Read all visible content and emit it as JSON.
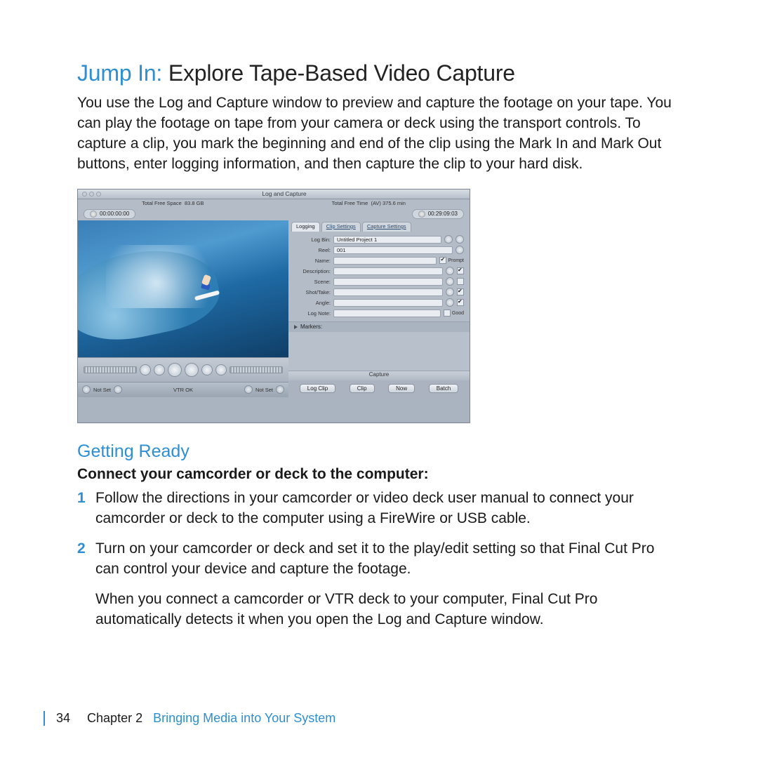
{
  "heading": {
    "jump": "Jump In:",
    "rest": " Explore Tape-Based Video Capture"
  },
  "intro": "You use the Log and Capture window to preview and capture the footage on your tape. You can play the footage on tape from your camera or deck using the transport controls. To capture a clip, you mark the beginning and end of the clip using the Mark In and Mark Out buttons, enter logging information, and then capture the clip to your hard disk.",
  "screenshot": {
    "title": "Log and Capture",
    "free_space_label": "Total Free Space",
    "free_space_value": "83.8 GB",
    "free_time_label": "Total Free Time",
    "free_time_value": "(AV) 375.6 min",
    "tc_in": "00:00:00:00",
    "tc_out": "00:29:09:03",
    "tabs": {
      "logging": "Logging",
      "clip": "Clip Settings",
      "capture": "Capture Settings"
    },
    "fields": {
      "log_bin_label": "Log Bin:",
      "log_bin_value": "Untitled Project 1",
      "reel_label": "Reel:",
      "reel_value": "001",
      "name_label": "Name:",
      "prompt_label": "Prompt",
      "description_label": "Description:",
      "scene_label": "Scene:",
      "shottake_label": "Shot/Take:",
      "angle_label": "Angle:",
      "lognote_label": "Log Note:",
      "good_label": "Good",
      "markers_label": "Markers:"
    },
    "markrow": {
      "notset": "Not Set",
      "vtr": "VTR OK"
    },
    "capture": {
      "header": "Capture",
      "logclip": "Log Clip",
      "clip": "Clip",
      "now": "Now",
      "batch": "Batch"
    }
  },
  "getting_ready": "Getting Ready",
  "connect_heading": "Connect your camcorder or deck to the computer:",
  "steps": [
    "Follow the directions in your camcorder or video deck user manual to connect your camcorder or deck to the computer using a FireWire or USB cable.",
    "Turn on your camcorder or deck and set it to the play/edit setting so that Final Cut Pro can control your device and capture the footage."
  ],
  "after_steps": "When you connect a camcorder or VTR deck to your computer, Final Cut Pro automatically detects it when you open the Log and Capture window.",
  "footer": {
    "page": "34",
    "chapter": "Chapter 2",
    "title": "Bringing Media into Your System"
  }
}
